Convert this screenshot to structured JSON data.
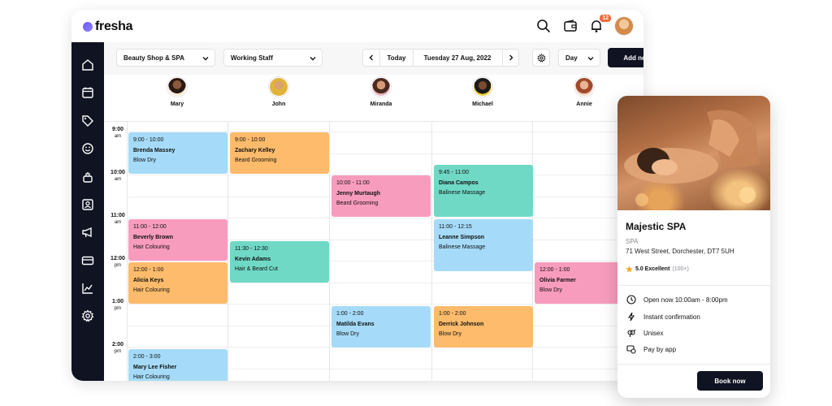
{
  "app": {
    "logo_text": "fresha",
    "notification_count": "12"
  },
  "toolbar": {
    "location": "Beauty Shop & SPA",
    "staff_filter": "Working Staff",
    "today_label": "Today",
    "date": "Tuesday 27 Aug, 2022",
    "view": "Day",
    "add_new": "Add new"
  },
  "staff": [
    {
      "name": "Mary"
    },
    {
      "name": "John"
    },
    {
      "name": "Miranda"
    },
    {
      "name": "Michael"
    },
    {
      "name": "Annie"
    }
  ],
  "times": [
    {
      "hour": "9:00",
      "ampm": "am"
    },
    {
      "hour": "10:00",
      "ampm": "am"
    },
    {
      "hour": "11:00",
      "ampm": "am"
    },
    {
      "hour": "12:00",
      "ampm": "pm"
    },
    {
      "hour": "1:00",
      "ampm": "pm"
    },
    {
      "hour": "2:00",
      "ampm": "pm"
    }
  ],
  "appointments": [
    {
      "time": "9:00 - 10:00",
      "client": "Brenda Massey",
      "service": "Blow Dry"
    },
    {
      "time": "9:00 - 10:00",
      "client": "Zachary Kelley",
      "service": "Beard Grooming"
    },
    {
      "time": "10:00 - 11:00",
      "client": "Jenny Murtaugh",
      "service": "Beard Grooming"
    },
    {
      "time": "9:45 - 11:00",
      "client": "Diana Campos",
      "service": "Balinese Massage"
    },
    {
      "time": "11:00 - 12:00",
      "client": "Beverly Brown",
      "service": "Hair Colouring"
    },
    {
      "time": "11:30 - 12:30",
      "client": "Kevin Adams",
      "service": "Hair & Beard Cut"
    },
    {
      "time": "11:00 - 12:15",
      "client": "Leanne Simpson",
      "service": "Balinese Massage"
    },
    {
      "time": "12:00 - 1:00",
      "client": "Alicia Keys",
      "service": "Hair Colouring"
    },
    {
      "time": "12:00 - 1:00",
      "client": "Olivia Farmer",
      "service": "Blow Dry"
    },
    {
      "time": "1:00 - 2:00",
      "client": "Matilda Evans",
      "service": "Blow Dry"
    },
    {
      "time": "1:00 - 2:00",
      "client": "Derrick Johnson",
      "service": "Blow Dry"
    },
    {
      "time": "2:00 - 3:00",
      "client": "Mary Lee Fisher",
      "service": "Hair Colouring"
    }
  ],
  "venue": {
    "name": "Majestic SPA",
    "category": "SPA",
    "address": "71 West Street, Dorchester, DT7 5UH",
    "rating": "5.0 Excellent",
    "reviews": "(100+)",
    "features": [
      "Open now 10:00am - 8:00pm",
      "Instant confirmation",
      "Unisex",
      "Pay by app"
    ],
    "book_label": "Book now"
  },
  "colors": {
    "blue": "#a5dbf8",
    "orange": "#fdbb6b",
    "pink": "#f89cbd",
    "teal": "#6fd9c6",
    "dark": "#0f1322"
  }
}
